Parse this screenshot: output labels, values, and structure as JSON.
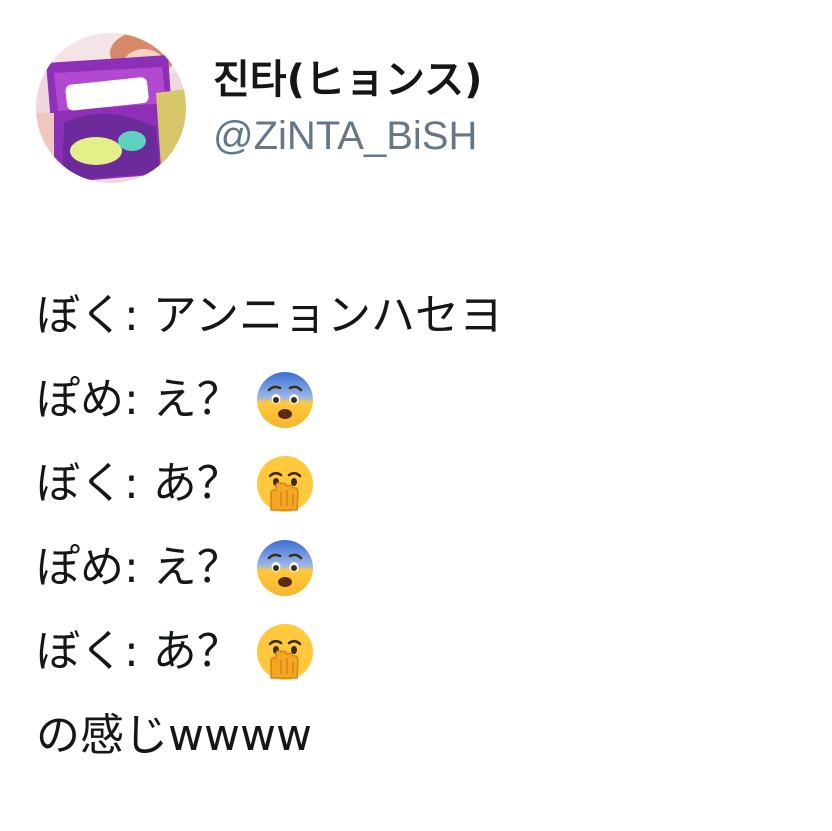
{
  "tweet": {
    "display_name": "진타(ヒョンス)",
    "handle": "@ZiNTA_BiSH",
    "avatar_icon": "profile-photo-avatar",
    "lines": [
      {
        "text": "ぼく: アンニョンハセヨ",
        "emoji": ""
      },
      {
        "text": "ぽめ: え？",
        "emoji": "fearful-face-icon"
      },
      {
        "text": "ぼく: あ？",
        "emoji": "face-with-hand-over-mouth-icon"
      },
      {
        "text": "ぽめ: え？",
        "emoji": "fearful-face-icon"
      },
      {
        "text": "ぼく: あ？",
        "emoji": "face-with-hand-over-mouth-icon"
      },
      {
        "text": "の感じwwww",
        "emoji": ""
      }
    ]
  },
  "colors": {
    "text": "#14171a",
    "handle": "#657786",
    "background": "#ffffff",
    "emoji_yellow": "#ffc83d"
  }
}
